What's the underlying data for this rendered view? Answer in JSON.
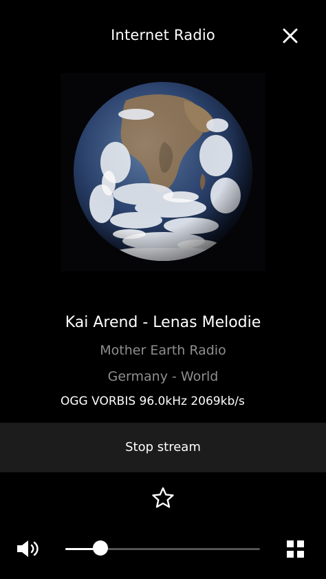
{
  "header": {
    "title": "Internet Radio",
    "close_icon": "close-icon"
  },
  "now_playing": {
    "artwork_icon": "earth-globe-artwork",
    "track_title": "Kai Arend - Lenas Melodie",
    "station_name": "Mother Earth Radio",
    "station_location": "Germany - World",
    "stream_info": "OGG VORBIS 96.0kHz 2069kb/s"
  },
  "controls": {
    "stop_label": "Stop stream",
    "favorite_icon": "star-outline-icon",
    "volume_icon": "speaker-volume-icon",
    "volume_level": 0.18,
    "grid_icon": "grid-view-icon"
  },
  "colors": {
    "background": "#000000",
    "button_background": "#1c1c1c",
    "primary_text": "#ffffff",
    "secondary_text": "#8f8f8f",
    "slider_track": "#555555"
  }
}
